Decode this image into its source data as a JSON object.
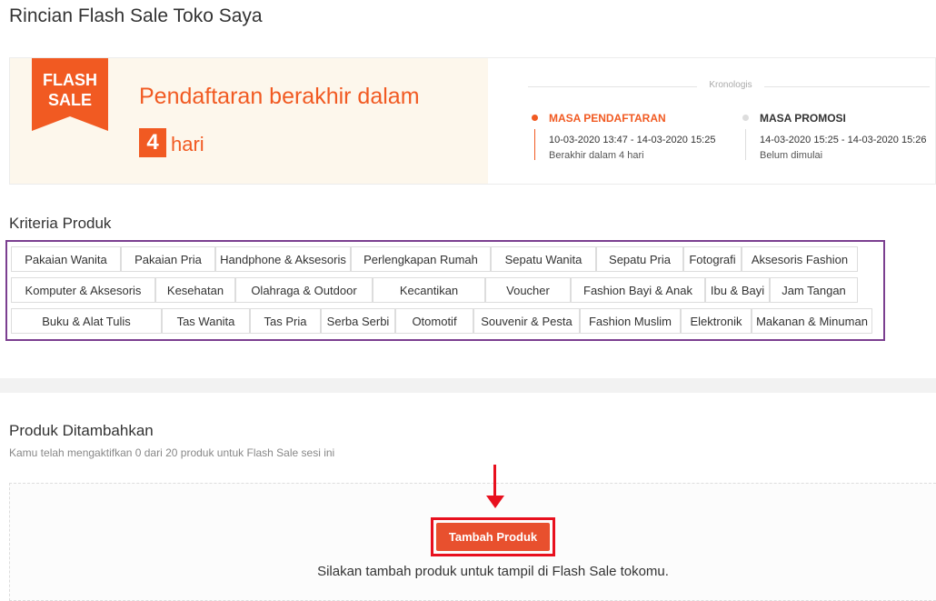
{
  "page_title": "Rincian Flash Sale Toko Saya",
  "banner": {
    "logo_text_line1": "FLASH",
    "logo_text_line2": "SALE",
    "headline": "Pendaftaran berakhir dalam",
    "days_value": "4",
    "days_unit": "hari",
    "timeline_title": "Kronologis",
    "phases": [
      {
        "name": "MASA PENDAFTARAN",
        "dates": "10-03-2020 13:47 - 14-03-2020 15:25",
        "status": "Berakhir dalam 4 hari",
        "active": true
      },
      {
        "name": "MASA PROMOSI",
        "dates": "14-03-2020 15:25 - 14-03-2020 15:26",
        "status": "Belum dimulai",
        "active": false
      }
    ]
  },
  "criteria": {
    "title": "Kriteria Produk",
    "rows": [
      [
        "Pakaian Wanita",
        "Pakaian Pria",
        "Handphone & Aksesoris",
        "Perlengkapan Rumah",
        "Sepatu Wanita",
        "Sepatu Pria",
        "Fotografi",
        "Aksesoris Fashion"
      ],
      [
        "Komputer & Aksesoris",
        "Kesehatan",
        "Olahraga & Outdoor",
        "Kecantikan",
        "Voucher",
        "Fashion Bayi & Anak",
        "Ibu & Bayi",
        "Jam Tangan"
      ],
      [
        "Buku & Alat Tulis",
        "Tas Wanita",
        "Tas Pria",
        "Serba Serbi",
        "Otomotif",
        "Souvenir & Pesta",
        "Fashion Muslim",
        "Elektronik",
        "Makanan & Minuman"
      ]
    ]
  },
  "added_products": {
    "title": "Produk Ditambahkan",
    "subtitle": "Kamu telah mengaktifkan 0 dari 20 produk untuk Flash Sale sesi ini",
    "add_button_label": "Tambah Produk",
    "empty_hint": "Silakan tambah produk untuk tampil di Flash Sale tokomu."
  },
  "colors": {
    "accent": "#f15a22",
    "annotation_red": "#e8101e",
    "criteria_border": "#7b3f90"
  }
}
